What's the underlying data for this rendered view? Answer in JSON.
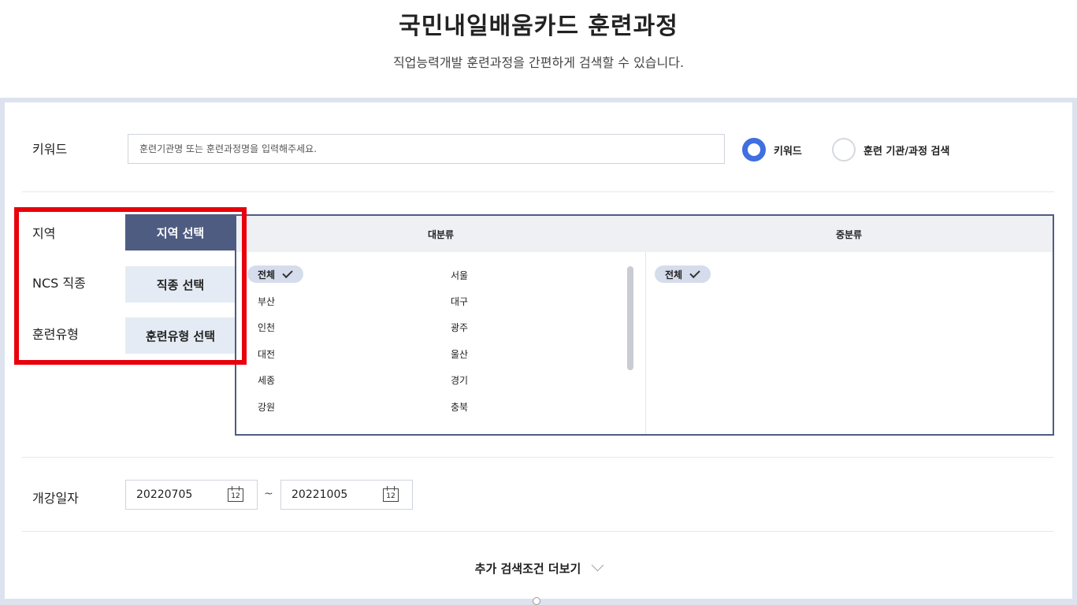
{
  "header": {
    "title": "국민내일배움카드 훈련과정",
    "subtitle": "직업능력개발 훈련과정을 간편하게 검색할 수 있습니다."
  },
  "keyword": {
    "label": "키워드",
    "placeholder": "훈련기관명 또는 훈련과정명을 입력해주세요.",
    "value": "",
    "options": [
      {
        "label": "키워드",
        "checked": true
      },
      {
        "label": "훈련 기관/과정 검색",
        "checked": false
      }
    ]
  },
  "filters": [
    {
      "label": "지역",
      "button": "지역 선택",
      "active": true
    },
    {
      "label": "NCS 직종",
      "button": "직종 선택",
      "active": false
    },
    {
      "label": "훈련유형",
      "button": "훈련유형 선택",
      "active": false
    }
  ],
  "category": {
    "major_header": "대분류",
    "minor_header": "중분류",
    "regions": [
      "전체",
      "서울",
      "부산",
      "대구",
      "인천",
      "광주",
      "대전",
      "울산",
      "세종",
      "경기",
      "강원",
      "충북"
    ],
    "selected_region": "전체",
    "minor_items": [
      "전체"
    ]
  },
  "date": {
    "label": "개강일자",
    "start": "20220705",
    "end": "20221005",
    "separator": "~",
    "calendar_icon_text": "12"
  },
  "more": {
    "label": "추가 검색조건 더보기"
  },
  "colors": {
    "accent": "#3f6fe0",
    "active_button": "#4f5c82",
    "highlight": "#e8000b"
  }
}
